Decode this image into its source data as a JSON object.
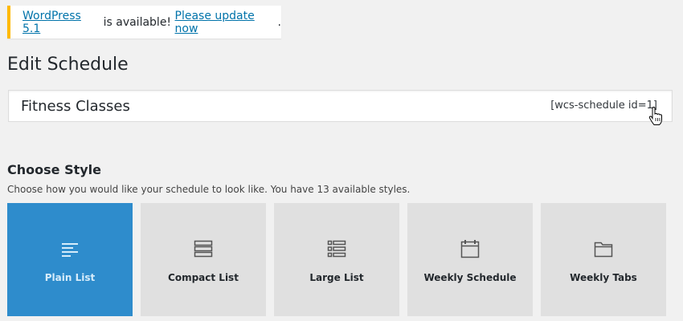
{
  "notice": {
    "link_version": "WordPress 5.1",
    "middle_text": " is available! ",
    "link_update": "Please update now",
    "end_text": "."
  },
  "page": {
    "title": "Edit Schedule"
  },
  "schedule": {
    "title_value": "Fitness Classes",
    "shortcode": "[wcs-schedule id=1]"
  },
  "choose_style": {
    "heading": "Choose Style",
    "description": "Choose how you would like your schedule to look like. You have 13 available styles.",
    "options": [
      {
        "label": "Plain List",
        "icon": "plain-list-icon",
        "selected": true
      },
      {
        "label": "Compact List",
        "icon": "compact-list-icon",
        "selected": false
      },
      {
        "label": "Large List",
        "icon": "large-list-icon",
        "selected": false
      },
      {
        "label": "Weekly Schedule",
        "icon": "calendar-icon",
        "selected": false
      },
      {
        "label": "Weekly Tabs",
        "icon": "folder-icon",
        "selected": false
      }
    ]
  },
  "colors": {
    "accent": "#2e8ccc",
    "link": "#0073aa",
    "notice_border": "#ffb900",
    "card_bg": "#e0e0e0"
  }
}
